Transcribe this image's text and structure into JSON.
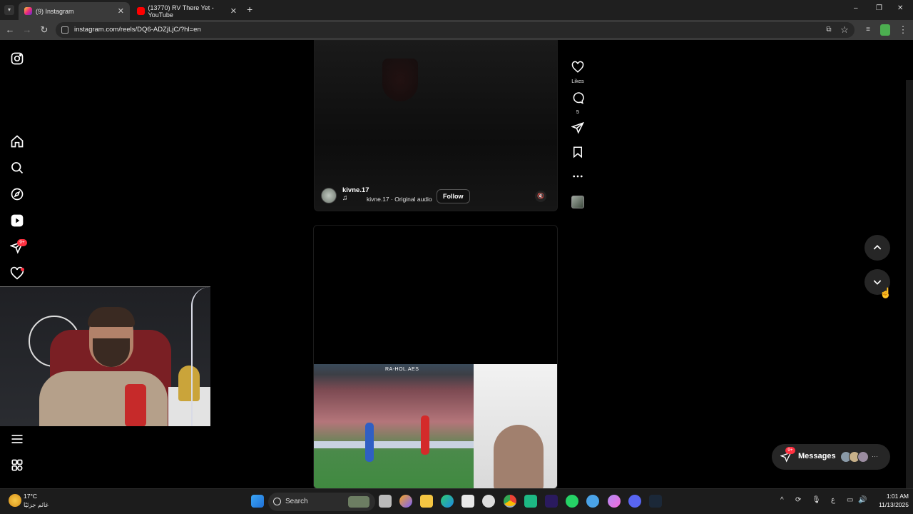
{
  "browser": {
    "tabs": [
      {
        "title": "(9) Instagram",
        "active": true
      },
      {
        "title": "(13770) RV There Yet - YouTube",
        "active": false
      }
    ],
    "new_tab": "+",
    "url": "instagram.com/reels/DQ6-ADZjLjC/?hl=en",
    "window_controls": {
      "minimize": "–",
      "restore": "❐",
      "close": "✕"
    }
  },
  "sidebar": {
    "notifications_badge": "9+"
  },
  "reel": {
    "username": "kivne.17",
    "audio": "kivne.17 · Original audio",
    "follow_label": "Follow",
    "mute_icon": "🔇"
  },
  "actions": {
    "likes_label": "Likes",
    "comments_count": "5"
  },
  "video": {
    "brand_text": "RA-HOL.AES"
  },
  "messages": {
    "label": "Messages",
    "badge": "9+",
    "more": "···"
  },
  "taskbar": {
    "temperature": "17°C",
    "condition": "غائم جزئيًا",
    "search_label": "Search",
    "time": "1:01 AM",
    "date": "11/13/2025",
    "lang": "ع"
  },
  "colors": {
    "accent_red": "#ff3040",
    "panel": "#262626"
  }
}
